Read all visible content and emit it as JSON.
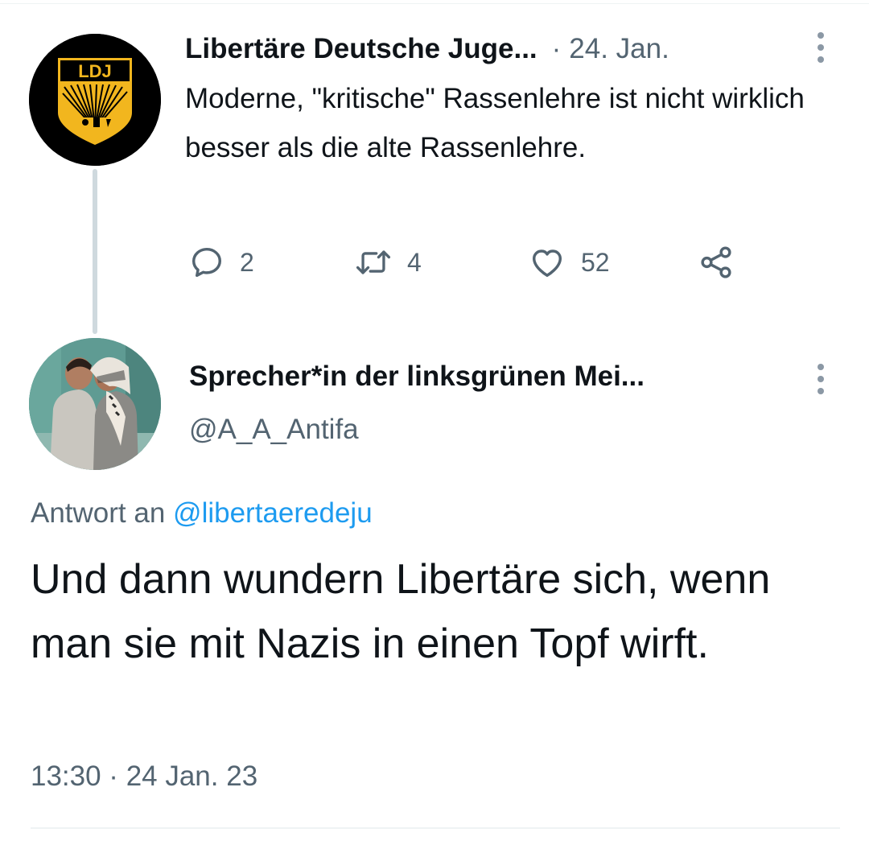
{
  "parent_tweet": {
    "author_name": "Libertäre Deutsche Juge...",
    "separator": "·",
    "date": "24. Jan.",
    "avatar_logo_text": "LDJ",
    "text": "Moderne, \"kritische\" Rassenlehre ist nicht wirklich besser als die alte Rassenlehre.",
    "replies_count": "2",
    "retweets_count": "4",
    "likes_count": "52"
  },
  "reply_tweet": {
    "author_name": "Sprecher*in der linksgrünen Mei...",
    "handle": "@A_A_Antifa",
    "reply_to_prefix": "Antwort an",
    "reply_to_mention": "@libertaeredeju",
    "text": "Und dann wundern Libertäre sich, wenn man sie mit Nazis in einen Topf wirft.",
    "timestamp": "13:30 · 24 Jan. 23"
  },
  "colors": {
    "text_primary": "#0f1419",
    "text_secondary": "#536471",
    "link": "#1d9bf0",
    "thread_line": "#cfd9de",
    "ldj_gold": "#f2b61e"
  },
  "icons": {
    "reply": "speech-bubble-icon",
    "retweet": "retweet-icon",
    "like": "heart-icon",
    "share": "share-icon",
    "more": "vertical-ellipsis-icon"
  }
}
